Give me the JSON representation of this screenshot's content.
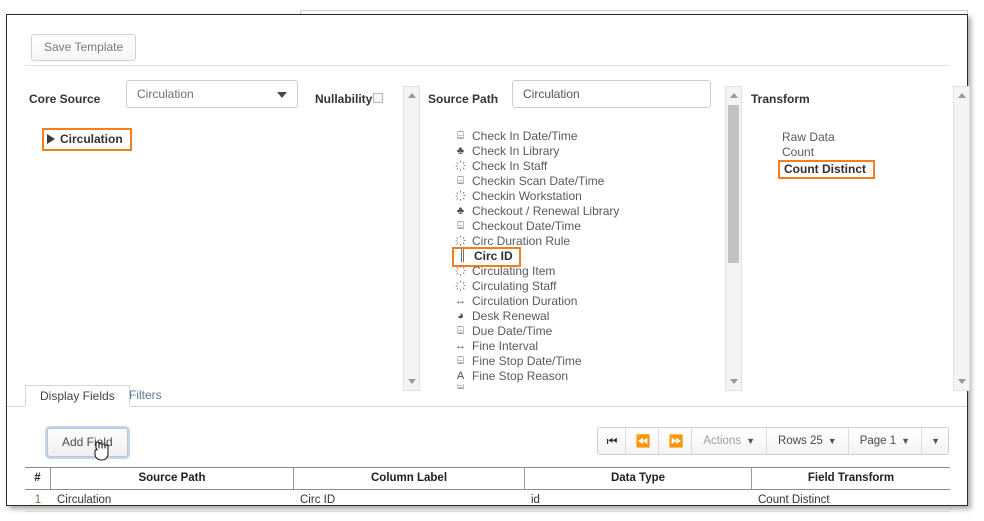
{
  "toolbar": {
    "save_template": "Save Template"
  },
  "core_source": {
    "label": "Core Source",
    "selected": "Circulation",
    "tree_node": "Circulation"
  },
  "nullability": {
    "label": "Nullability",
    "checked": false
  },
  "source_path": {
    "label": "Source Path",
    "value": "Circulation",
    "items": [
      {
        "icon": "calendar-icon",
        "glyph": "⌸",
        "label": "Check In Date/Time",
        "selected": false
      },
      {
        "icon": "library-icon",
        "glyph": "♣",
        "label": "Check In Library",
        "selected": false
      },
      {
        "icon": "link-icon",
        "glyph": "҉",
        "label": "Check In Staff",
        "selected": false
      },
      {
        "icon": "calendar-icon",
        "glyph": "⌸",
        "label": "Checkin Scan Date/Time",
        "selected": false
      },
      {
        "icon": "link-icon",
        "glyph": "҉",
        "label": "Checkin Workstation",
        "selected": false
      },
      {
        "icon": "library-icon",
        "glyph": "♣",
        "label": "Checkout / Renewal Library",
        "selected": false
      },
      {
        "icon": "calendar-icon",
        "glyph": "⌸",
        "label": "Checkout Date/Time",
        "selected": false
      },
      {
        "icon": "link-icon",
        "glyph": "҉",
        "label": "Circ Duration Rule",
        "selected": false
      },
      {
        "icon": "id-icon",
        "glyph": "║",
        "label": "Circ ID",
        "selected": true
      },
      {
        "icon": "link-icon",
        "glyph": "҉",
        "label": "Circulating Item",
        "selected": false
      },
      {
        "icon": "link-icon",
        "glyph": "҉",
        "label": "Circulating Staff",
        "selected": false
      },
      {
        "icon": "duration-icon",
        "glyph": "↔",
        "label": "Circulation Duration",
        "selected": false
      },
      {
        "icon": "boolean-icon",
        "glyph": "◕",
        "label": "Desk Renewal",
        "selected": false
      },
      {
        "icon": "calendar-icon",
        "glyph": "⌸",
        "label": "Due Date/Time",
        "selected": false
      },
      {
        "icon": "duration-icon",
        "glyph": "↔",
        "label": "Fine Interval",
        "selected": false
      },
      {
        "icon": "calendar-icon",
        "glyph": "⌸",
        "label": "Fine Stop Date/Time",
        "selected": false
      },
      {
        "icon": "text-icon",
        "glyph": "A",
        "label": "Fine Stop Reason",
        "selected": false
      }
    ]
  },
  "transform": {
    "label": "Transform",
    "items": [
      {
        "label": "Raw Data",
        "selected": false
      },
      {
        "label": "Count",
        "selected": false
      },
      {
        "label": "Count Distinct",
        "selected": true
      }
    ]
  },
  "tabs": [
    {
      "label": "Display Fields",
      "active": true
    },
    {
      "label": "Filters",
      "active": false
    }
  ],
  "actions": {
    "add_field": "Add Field",
    "pager": [
      {
        "name": "first-page-button",
        "label": "⏮",
        "disabled": false
      },
      {
        "name": "previous-page-button",
        "label": "⏪",
        "disabled": false
      },
      {
        "name": "next-page-button",
        "label": "⏩",
        "disabled": false
      },
      {
        "name": "actions-menu",
        "label": "Actions",
        "disabled": true,
        "caret": true
      },
      {
        "name": "rows-menu",
        "label": "Rows 25",
        "disabled": false,
        "caret": true
      },
      {
        "name": "page-menu",
        "label": "Page 1",
        "disabled": false,
        "caret": true
      },
      {
        "name": "more-menu",
        "label": "",
        "disabled": false,
        "caret": true
      }
    ]
  },
  "table": {
    "headers": [
      "#",
      "Source Path",
      "Column Label",
      "Data Type",
      "Field Transform"
    ],
    "rows": [
      {
        "num": "1",
        "source_path": "Circulation",
        "column_label": "Circ ID",
        "data_type": "id",
        "field_transform": "Count Distinct"
      }
    ]
  },
  "colors": {
    "highlight": "#ef7f1f",
    "focus_ring": "#bcd6ef",
    "header_text": "#1f1f1f"
  }
}
